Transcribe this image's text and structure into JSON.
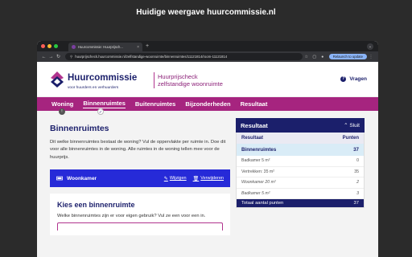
{
  "caption": "Huidige weergave huurcommissie.nl",
  "browser": {
    "tab_title": "Huurcommissie: Huurprijsch...",
    "tab_close": "×",
    "new_tab": "+",
    "url": "huurprijscheck.huurcommissie.nl/zelfstandige-woonruimte/binnenruimtes/11121814/room-11121814",
    "relaunch": "Relaunch to update"
  },
  "header": {
    "logo_name": "Huurcommissie",
    "logo_tagline": "voor huurders en verhuurders",
    "service_line1": "Huurprijscheck",
    "service_line2": "zelfstandige woonruimte",
    "help_label": "Vragen"
  },
  "nav": {
    "items": [
      "Woning",
      "Binnenruimtes",
      "Buitenruimtes",
      "Bijzonderheden",
      "Resultaat"
    ],
    "step1": "!",
    "step2": "✓"
  },
  "main": {
    "title": "Binnenruimtes",
    "intro": "Dit welke binnenruimtes bestaat de woning? Vul de oppervlakte per ruimte in. Doe dit voor alle binnenruimtes in de woning. Alle ruimtes in de woning tellen mee voor de huurprijs.",
    "room_name": "Woonkamer",
    "edit_label": "Wijzigen",
    "delete_label": "Verwijderen",
    "choose_title": "Kies een binnenruimte",
    "choose_text": "Welke binnenruimtes zijn er voor eigen gebruik? Vul ze een voor een in."
  },
  "result": {
    "title": "Resultaat",
    "close_label": "Sluit",
    "col_left": "Resultaat",
    "col_right": "Punten",
    "section_label": "Binnenruimtes",
    "section_value": "37",
    "rows": [
      {
        "label": "Badkamer 5 m²",
        "value": "0"
      },
      {
        "label": "Vertrekken: 35 m²",
        "value": "35"
      },
      {
        "label": "Woonkamer 20 m²",
        "value": "2"
      },
      {
        "label": "Badkamer 5 m²",
        "value": "3"
      }
    ],
    "total_label": "Totaal aantal punten",
    "total_value": "37"
  }
}
